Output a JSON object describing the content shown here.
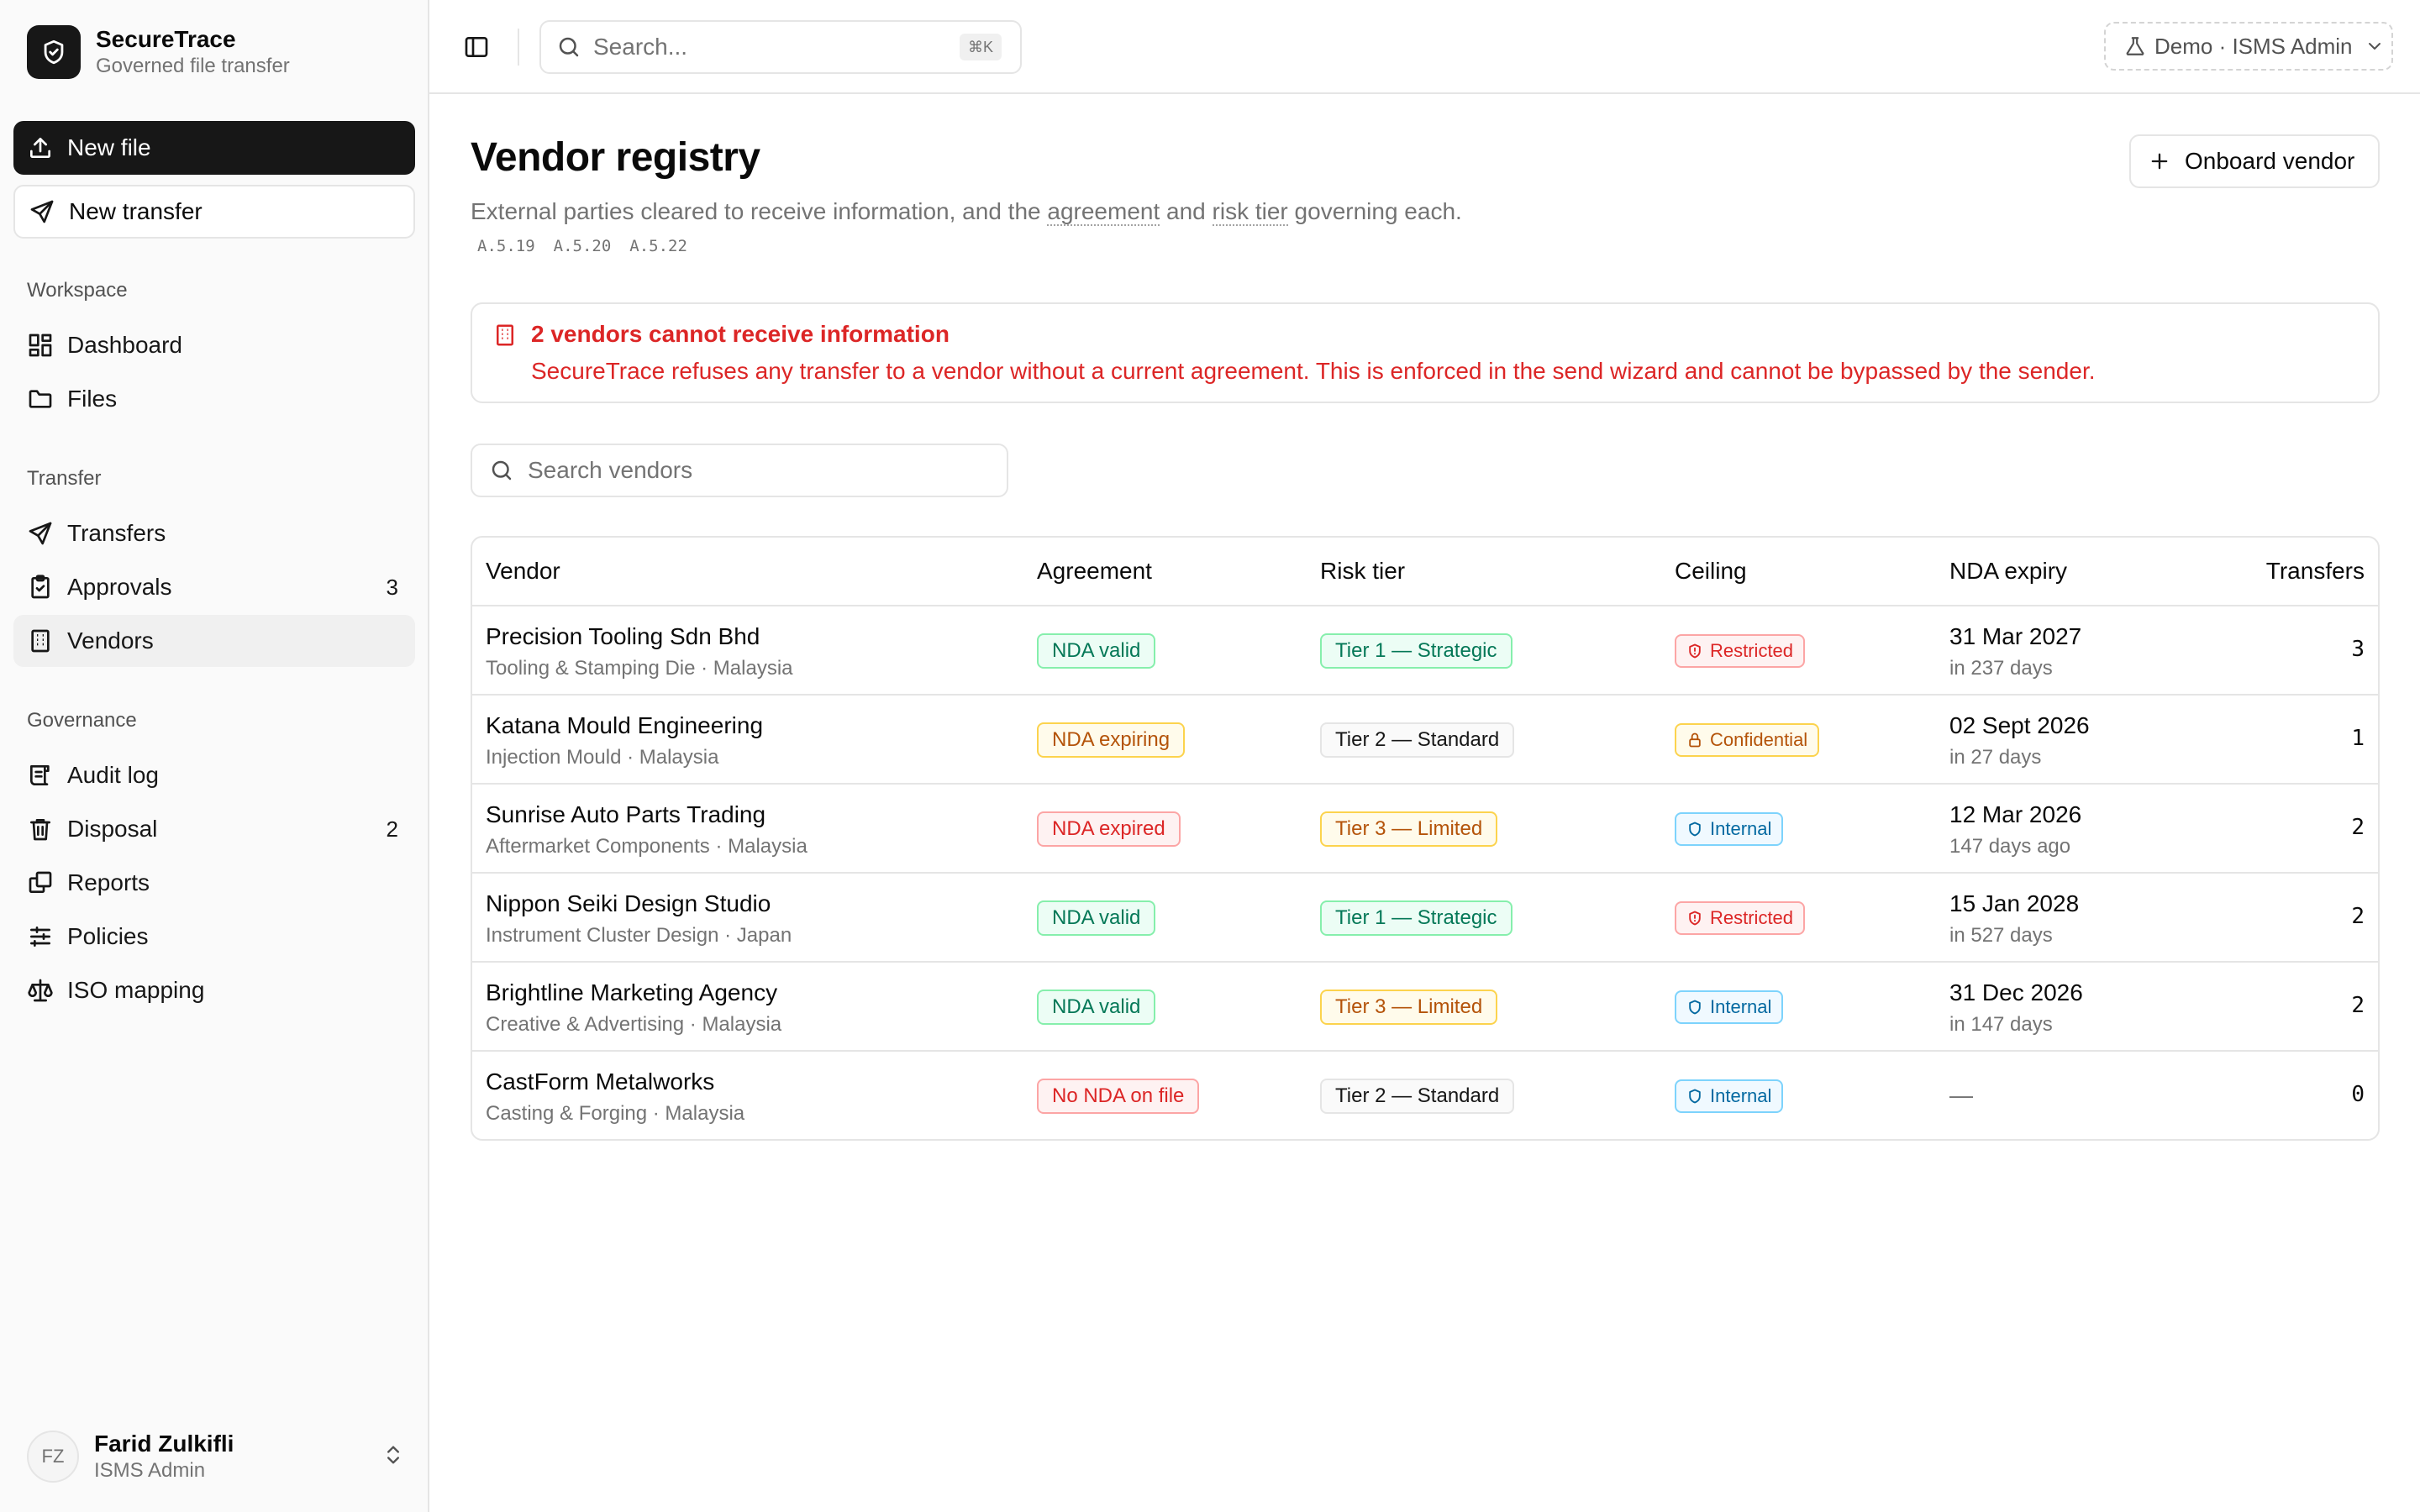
{
  "brand": {
    "name": "SecureTrace",
    "tagline": "Governed file transfer"
  },
  "sidebar": {
    "new_file": "New file",
    "new_transfer": "New transfer",
    "groups": {
      "workspace": "Workspace",
      "transfer": "Transfer",
      "governance": "Governance"
    },
    "items": {
      "dashboard": "Dashboard",
      "files": "Files",
      "transfers": "Transfers",
      "approvals": "Approvals",
      "approvals_count": "3",
      "vendors": "Vendors",
      "audit_log": "Audit log",
      "disposal": "Disposal",
      "disposal_count": "2",
      "reports": "Reports",
      "policies": "Policies",
      "iso_mapping": "ISO mapping"
    },
    "user": {
      "initials": "FZ",
      "name": "Farid Zulkifli",
      "role": "ISMS Admin"
    }
  },
  "topbar": {
    "search_placeholder": "Search...",
    "shortcut": "⌘K",
    "demo_label": "Demo · ISMS Admin"
  },
  "page": {
    "title": "Vendor registry",
    "desc_1": "External parties cleared to receive information, and the ",
    "desc_term_1": "agreement",
    "desc_2": " and ",
    "desc_term_2": "risk tier",
    "desc_3": " governing each.",
    "iso_refs": [
      "A.5.19",
      "A.5.20",
      "A.5.22"
    ],
    "onboard_label": "Onboard vendor"
  },
  "alert": {
    "title": "2 vendors cannot receive information",
    "body": "SecureTrace refuses any transfer to a vendor without a current agreement. This is enforced in the send wizard and cannot be bypassed by the sender."
  },
  "vendor_search_placeholder": "Search vendors",
  "table": {
    "headers": {
      "vendor": "Vendor",
      "agreement": "Agreement",
      "risk_tier": "Risk tier",
      "ceiling": "Ceiling",
      "nda_expiry": "NDA expiry",
      "transfers": "Transfers"
    },
    "rows": [
      {
        "name": "Precision Tooling Sdn Bhd",
        "sub": "Tooling & Stamping Die · Malaysia",
        "agreement": "NDA valid",
        "tier": "Tier 1 — Strategic",
        "ceiling": "Restricted",
        "expiry": "31 Mar 2027",
        "expiry_rel": "in 237 days",
        "transfers": "3"
      },
      {
        "name": "Katana Mould Engineering",
        "sub": "Injection Mould · Malaysia",
        "agreement": "NDA expiring",
        "tier": "Tier 2 — Standard",
        "ceiling": "Confidential",
        "expiry": "02 Sept 2026",
        "expiry_rel": "in 27 days",
        "transfers": "1"
      },
      {
        "name": "Sunrise Auto Parts Trading",
        "sub": "Aftermarket Components · Malaysia",
        "agreement": "NDA expired",
        "tier": "Tier 3 — Limited",
        "ceiling": "Internal",
        "expiry": "12 Mar 2026",
        "expiry_rel": "147 days ago",
        "transfers": "2"
      },
      {
        "name": "Nippon Seiki Design Studio",
        "sub": "Instrument Cluster Design · Japan",
        "agreement": "NDA valid",
        "tier": "Tier 1 — Strategic",
        "ceiling": "Restricted",
        "expiry": "15 Jan 2028",
        "expiry_rel": "in 527 days",
        "transfers": "2"
      },
      {
        "name": "Brightline Marketing Agency",
        "sub": "Creative & Advertising · Malaysia",
        "agreement": "NDA valid",
        "tier": "Tier 3 — Limited",
        "ceiling": "Internal",
        "expiry": "31 Dec 2026",
        "expiry_rel": "in 147 days",
        "transfers": "2"
      },
      {
        "name": "CastForm Metalworks",
        "sub": "Casting & Forging · Malaysia",
        "agreement": "No NDA on file",
        "tier": "Tier 2 — Standard",
        "ceiling": "Internal",
        "expiry": "—",
        "expiry_rel": "",
        "transfers": "0"
      }
    ]
  },
  "colors": {
    "primary": "#171717",
    "danger": "#dc2626",
    "success": "#047857",
    "warning": "#b45309",
    "info": "#0369a1"
  }
}
